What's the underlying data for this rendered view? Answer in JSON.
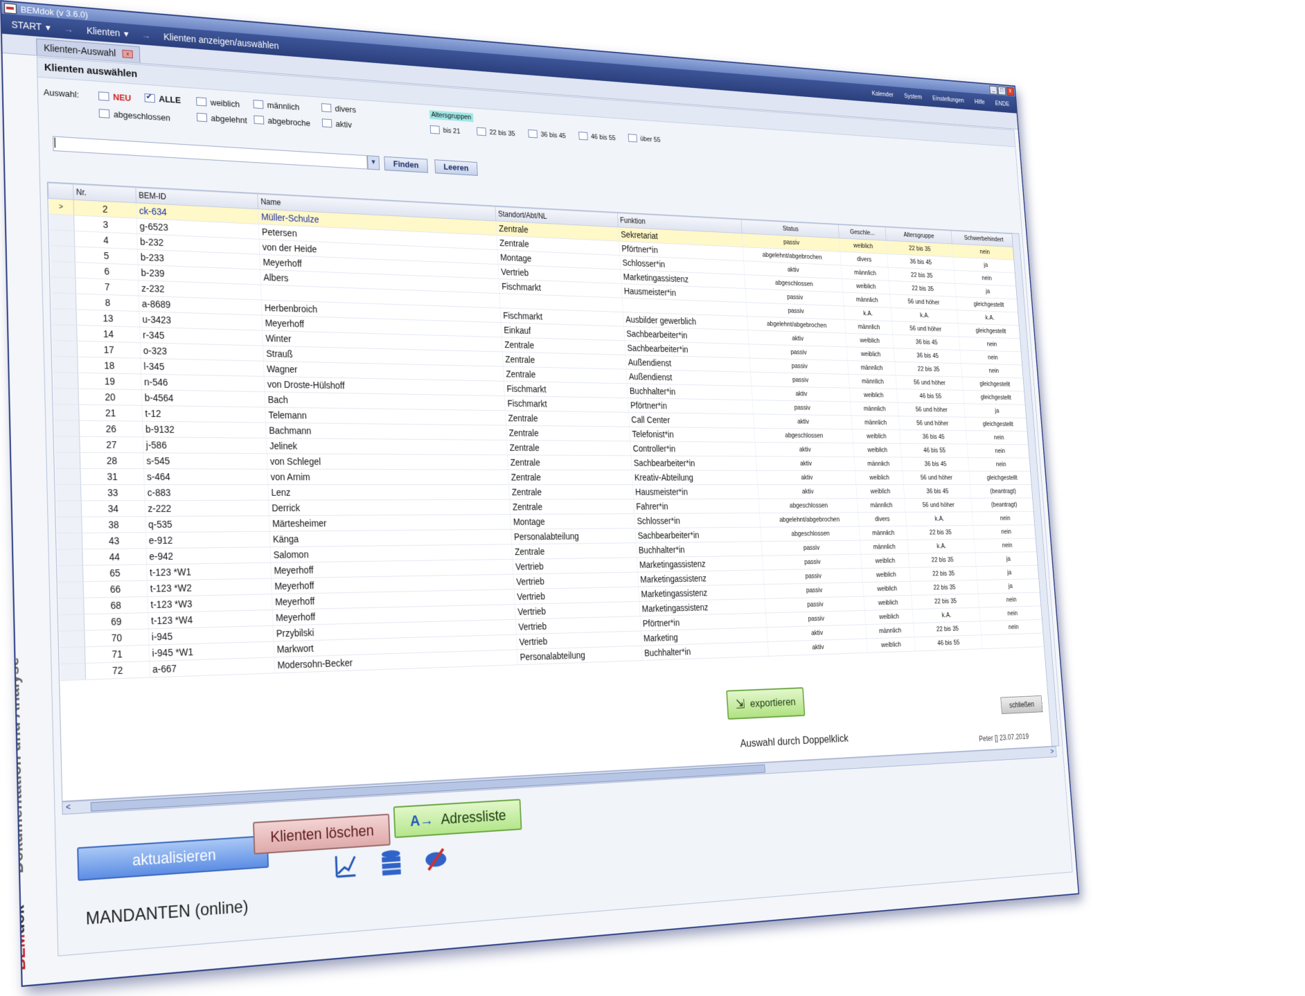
{
  "window": {
    "title": "BEMdok (v 3.6.0)",
    "min": "_",
    "max": "□",
    "close": "x"
  },
  "menu": {
    "start": "START",
    "klienten": "Klienten",
    "breadcrumb": "Klienten anzeigen/auswählen",
    "arrow": "→",
    "right": [
      "Kalender",
      "System",
      "Einstellungen",
      "Hilfe",
      "ENDE"
    ]
  },
  "tab": {
    "label": "Klienten-Auswahl",
    "close": "x"
  },
  "sidebar": {
    "brand_part1": "BEM",
    "brand_part2": "dok",
    "subtitle": "Dokumentation und Analyse"
  },
  "panel": {
    "title": "Klienten auswählen",
    "auswahl_label": "Auswahl:",
    "filters": {
      "neu": "NEU",
      "alle": "ALLE",
      "weiblich": "weiblich",
      "maennlich": "männlich",
      "divers": "divers",
      "abgeschlossen": "abgeschlossen",
      "abgelehnt": "abgelehnt",
      "abgebroche": "abgebroche",
      "aktiv": "aktiv"
    },
    "altersgruppen": {
      "label": "Altersgruppen",
      "items": [
        "bis 21",
        "22 bis 35",
        "36 bis 45",
        "46 bis 55",
        "über 55"
      ]
    },
    "search": {
      "value": "|",
      "finden": "Finden",
      "leeren": "Leeren"
    }
  },
  "table": {
    "columns": [
      "Nr.",
      "BEM-ID",
      "Name",
      "Standort/Abt/NL",
      "Funktion",
      "Status",
      "Geschle...",
      "Altersgruppe",
      "Schwerbehindert"
    ],
    "rows": [
      {
        "nr": "2",
        "id": "ck-634",
        "name": "Müller-Schulze",
        "standort": "Zentrale",
        "funktion": "Sekretariat",
        "status": "passiv",
        "geschlecht": "weiblich",
        "alter": "22 bis 35",
        "schwb": "nein"
      },
      {
        "nr": "3",
        "id": "g-6523",
        "name": "Petersen",
        "standort": "Zentrale",
        "funktion": "Pförtner*in",
        "status": "abgelehnt/abgebrochen",
        "geschlecht": "divers",
        "alter": "36 bis 45",
        "schwb": "ja"
      },
      {
        "nr": "4",
        "id": "b-232",
        "name": "von der Heide",
        "standort": "Montage",
        "funktion": "Schlosser*in",
        "status": "aktiv",
        "geschlecht": "männlich",
        "alter": "22 bis 35",
        "schwb": "nein"
      },
      {
        "nr": "5",
        "id": "b-233",
        "name": "Meyerhoff",
        "standort": "Vertrieb",
        "funktion": "Marketingassistenz",
        "status": "abgeschlossen",
        "geschlecht": "weiblich",
        "alter": "22 bis 35",
        "schwb": "ja"
      },
      {
        "nr": "6",
        "id": "b-239",
        "name": "Albers",
        "standort": "Fischmarkt",
        "funktion": "Hausmeister*in",
        "status": "passiv",
        "geschlecht": "männlich",
        "alter": "56 und höher",
        "schwb": "gleichgestellt"
      },
      {
        "nr": "7",
        "id": "z-232",
        "name": "",
        "standort": "",
        "funktion": "",
        "status": "passiv",
        "geschlecht": "k.A.",
        "alter": "k.A.",
        "schwb": "k.A."
      },
      {
        "nr": "8",
        "id": "a-8689",
        "name": "Herbenbroich",
        "standort": "Fischmarkt",
        "funktion": "Ausbilder gewerblich",
        "status": "abgelehnt/abgebrochen",
        "geschlecht": "männlich",
        "alter": "56 und höher",
        "schwb": "gleichgestellt"
      },
      {
        "nr": "13",
        "id": "u-3423",
        "name": "Meyerhoff",
        "standort": "Einkauf",
        "funktion": "Sachbearbeiter*in",
        "status": "aktiv",
        "geschlecht": "weiblich",
        "alter": "36 bis 45",
        "schwb": "nein"
      },
      {
        "nr": "14",
        "id": "r-345",
        "name": "Winter",
        "standort": "Zentrale",
        "funktion": "Sachbearbeiter*in",
        "status": "passiv",
        "geschlecht": "weiblich",
        "alter": "36 bis 45",
        "schwb": "nein"
      },
      {
        "nr": "17",
        "id": "o-323",
        "name": "Strauß",
        "standort": "Zentrale",
        "funktion": "Außendienst",
        "status": "passiv",
        "geschlecht": "männlich",
        "alter": "22 bis 35",
        "schwb": "nein"
      },
      {
        "nr": "18",
        "id": "l-345",
        "name": "Wagner",
        "standort": "Zentrale",
        "funktion": "Außendienst",
        "status": "passiv",
        "geschlecht": "männlich",
        "alter": "56 und höher",
        "schwb": "gleichgestellt"
      },
      {
        "nr": "19",
        "id": "n-546",
        "name": "von Droste-Hülshoff",
        "standort": "Fischmarkt",
        "funktion": "Buchhalter*in",
        "status": "aktiv",
        "geschlecht": "weiblich",
        "alter": "46 bis 55",
        "schwb": "gleichgestellt"
      },
      {
        "nr": "20",
        "id": "b-4564",
        "name": "Bach",
        "standort": "Fischmarkt",
        "funktion": "Pförtner*in",
        "status": "passiv",
        "geschlecht": "männlich",
        "alter": "56 und höher",
        "schwb": "ja"
      },
      {
        "nr": "21",
        "id": "t-12",
        "name": "Telemann",
        "standort": "Zentrale",
        "funktion": "Call Center",
        "status": "aktiv",
        "geschlecht": "männlich",
        "alter": "56 und höher",
        "schwb": "gleichgestellt"
      },
      {
        "nr": "26",
        "id": "b-9132",
        "name": "Bachmann",
        "standort": "Zentrale",
        "funktion": "Telefonist*in",
        "status": "abgeschlossen",
        "geschlecht": "weiblich",
        "alter": "36 bis 45",
        "schwb": "nein"
      },
      {
        "nr": "27",
        "id": "j-586",
        "name": "Jelinek",
        "standort": "Zentrale",
        "funktion": "Controller*in",
        "status": "aktiv",
        "geschlecht": "weiblich",
        "alter": "46 bis 55",
        "schwb": "nein"
      },
      {
        "nr": "28",
        "id": "s-545",
        "name": "von Schlegel",
        "standort": "Zentrale",
        "funktion": "Sachbearbeiter*in",
        "status": "aktiv",
        "geschlecht": "männlich",
        "alter": "36 bis 45",
        "schwb": "nein"
      },
      {
        "nr": "31",
        "id": "s-464",
        "name": "von Arnim",
        "standort": "Zentrale",
        "funktion": "Kreativ-Abteilung",
        "status": "aktiv",
        "geschlecht": "weiblich",
        "alter": "56 und höher",
        "schwb": "gleichgestellt"
      },
      {
        "nr": "33",
        "id": "c-883",
        "name": "Lenz",
        "standort": "Zentrale",
        "funktion": "Hausmeister*in",
        "status": "aktiv",
        "geschlecht": "weiblich",
        "alter": "36 bis 45",
        "schwb": "(beantragt)"
      },
      {
        "nr": "34",
        "id": "z-222",
        "name": "Derrick",
        "standort": "Zentrale",
        "funktion": "Fahrer*in",
        "status": "abgeschlossen",
        "geschlecht": "männlich",
        "alter": "56 und höher",
        "schwb": "(beantragt)"
      },
      {
        "nr": "38",
        "id": "q-535",
        "name": "Märtesheimer",
        "standort": "Montage",
        "funktion": "Schlosser*in",
        "status": "abgelehnt/abgebrochen",
        "geschlecht": "divers",
        "alter": "k.A.",
        "schwb": "nein"
      },
      {
        "nr": "43",
        "id": "e-912",
        "name": "Känga",
        "standort": "Personalabteilung",
        "funktion": "Sachbearbeiter*in",
        "status": "abgeschlossen",
        "geschlecht": "männlich",
        "alter": "22 bis 35",
        "schwb": "nein"
      },
      {
        "nr": "44",
        "id": "e-942",
        "name": "Salomon",
        "standort": "Zentrale",
        "funktion": "Buchhalter*in",
        "status": "passiv",
        "geschlecht": "männlich",
        "alter": "k.A.",
        "schwb": "nein"
      },
      {
        "nr": "65",
        "id": "t-123 *W1",
        "name": "Meyerhoff",
        "standort": "Vertrieb",
        "funktion": "Marketingassistenz",
        "status": "passiv",
        "geschlecht": "weiblich",
        "alter": "22 bis 35",
        "schwb": "ja"
      },
      {
        "nr": "66",
        "id": "t-123 *W2",
        "name": "Meyerhoff",
        "standort": "Vertrieb",
        "funktion": "Marketingassistenz",
        "status": "passiv",
        "geschlecht": "weiblich",
        "alter": "22 bis 35",
        "schwb": "ja"
      },
      {
        "nr": "68",
        "id": "t-123 *W3",
        "name": "Meyerhoff",
        "standort": "Vertrieb",
        "funktion": "Marketingassistenz",
        "status": "passiv",
        "geschlecht": "weiblich",
        "alter": "22 bis 35",
        "schwb": "ja"
      },
      {
        "nr": "69",
        "id": "t-123 *W4",
        "name": "Meyerhoff",
        "standort": "Vertrieb",
        "funktion": "Marketingassistenz",
        "status": "passiv",
        "geschlecht": "weiblich",
        "alter": "22 bis 35",
        "schwb": "nein"
      },
      {
        "nr": "70",
        "id": "i-945",
        "name": "Przybilski",
        "standort": "Vertrieb",
        "funktion": "Pförtner*in",
        "status": "passiv",
        "geschlecht": "weiblich",
        "alter": "k.A.",
        "schwb": "nein"
      },
      {
        "nr": "71",
        "id": "i-945 *W1",
        "name": "Markwort",
        "standort": "Vertrieb",
        "funktion": "Marketing",
        "status": "aktiv",
        "geschlecht": "männlich",
        "alter": "22 bis 35",
        "schwb": "nein"
      },
      {
        "nr": "72",
        "id": "a-667",
        "name": "Modersohn-Becker",
        "standort": "Personalabteilung",
        "funktion": "Buchhalter*in",
        "status": "aktiv",
        "geschlecht": "weiblich",
        "alter": "46 bis 55",
        "schwb": ""
      }
    ],
    "selected_row_marker": ">"
  },
  "buttons": {
    "aktualisieren": "aktualisieren",
    "klienten_loeschen": "Klienten löschen",
    "adressliste": "Adressliste",
    "exportieren": "exportieren",
    "schliessen": "schließen"
  },
  "hint": "Auswahl durch Doppelklick",
  "footer": {
    "mandanten": "MANDANTEN (online)",
    "user_date": "Peter [] 23.07.2019"
  },
  "scroll": {
    "left": "<",
    "right": ">",
    "mid": "|||"
  },
  "icons": [
    "chart-icon",
    "database-icon",
    "hide-icon"
  ],
  "colors": {
    "menubar": "#2b3f7d",
    "selected_row": "#fff8c8",
    "brand_red": "#c21f1f"
  }
}
